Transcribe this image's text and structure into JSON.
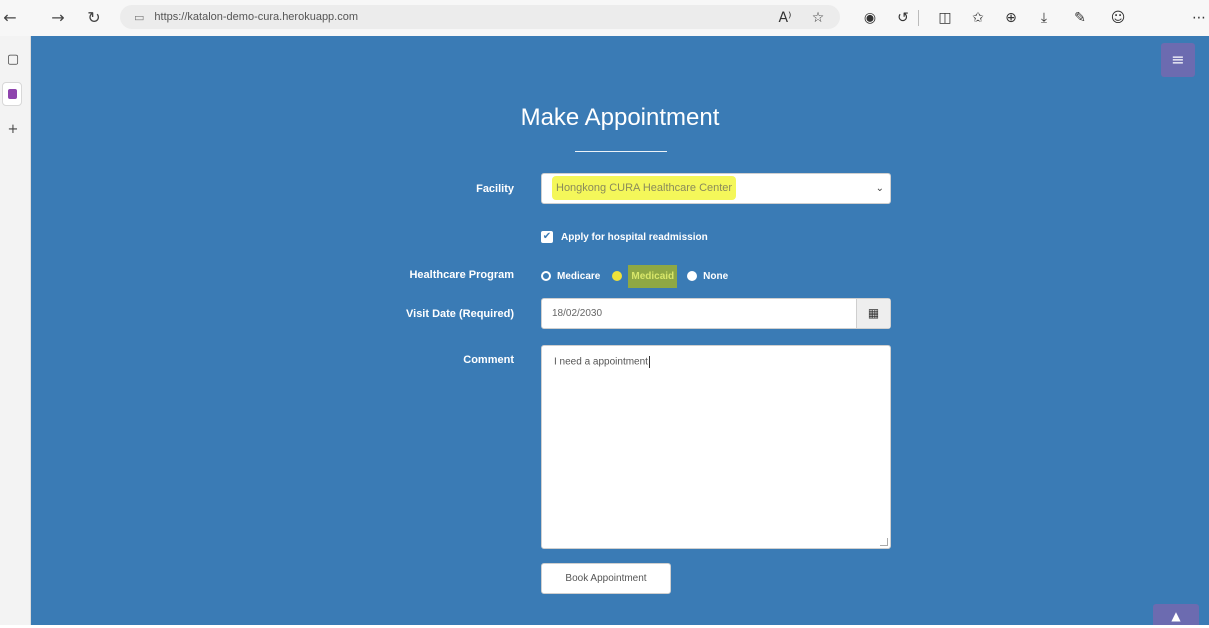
{
  "browser": {
    "url": "https://katalon-demo-cura.herokuapp.com",
    "back_icon": "←",
    "forward_icon": "→",
    "refresh_icon": "↻",
    "lock_icon": "▭",
    "read_aloud_icon": "A⁾",
    "favorite_icon": "☆",
    "icons": [
      "◉",
      "↺",
      "◫",
      "✩",
      "⊕",
      "⤓",
      "✎",
      "☺",
      "⋯"
    ]
  },
  "sidebar": {
    "icons": [
      "▢",
      "+"
    ]
  },
  "header": {
    "menu_icon": "≡"
  },
  "form": {
    "title": "Make Appointment",
    "facility_label": "Facility",
    "facility_value": "Hongkong CURA Healthcare Center",
    "facility_caret": "⌄",
    "readmission_check": "✔",
    "readmission_label": "Apply for hospital readmission",
    "program_label": "Healthcare Program",
    "program_options": [
      "Medicare",
      "Medicaid",
      "None"
    ],
    "visit_date_label": "Visit Date (Required)",
    "visit_date_value": "18/02/2030",
    "calendar_icon": "▦",
    "comment_label": "Comment",
    "comment_value": "I need a appointment",
    "book_button": "Book Appointment"
  },
  "scroll_top_icon": "▲",
  "colors": {
    "page_background": "#3a7bb5",
    "accent": "#6c6bb0",
    "highlight_yellow": "#f4f75a"
  }
}
